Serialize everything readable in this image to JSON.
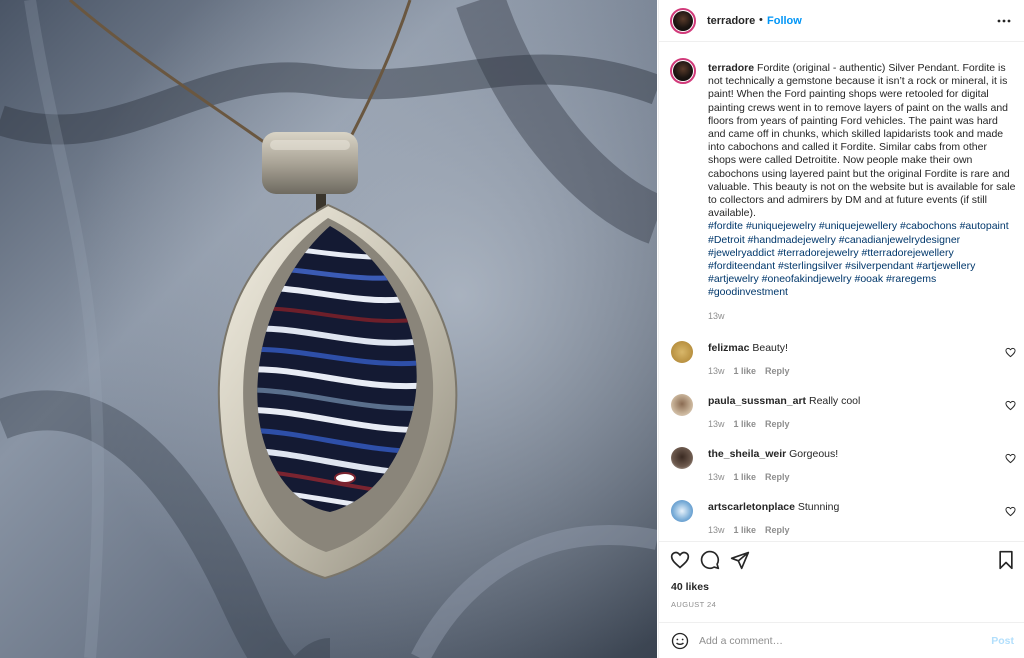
{
  "post": {
    "username": "terradore",
    "dot": "•",
    "follow_label": "Follow",
    "caption_username": "terradore",
    "caption_text": "Fordite (original - authentic) Silver Pendant. Fordite is not technically a gemstone because it isn’t a rock or mineral, it is paint! When the Ford painting shops were retooled for digital painting crews went in to remove layers of paint on the walls and floors from years of painting Ford vehicles. The paint was hard and came off in chunks, which skilled lapidarists took and made into cabochons and called it Fordite. Similar cabs from other shops were called Detroitite. Now people make their own cabochons using layered paint but the original Fordite is rare and valuable. This beauty is not on the website but is available for sale to collectors and admirers by DM and at future events (if still available).",
    "hashtags": "#fordite #uniquejewelry #uniquejewellery #cabochons #autopaint #Detroit #handmadejewelry #canadianjewelrydesigner #jewelryaddict #terradorejewelry #tterradorejewellery #forditeendant #sterlingsilver #silverpendant #artjewellery #artjewelry #oneofakindjewelry #ooak #raregems #goodinvestment",
    "caption_time": "13w",
    "likes": "40 likes",
    "date": "AUGUST 24"
  },
  "comments": [
    {
      "username": "felizmac",
      "text": "Beauty!",
      "time": "13w",
      "likes": "1 like",
      "reply": "Reply"
    },
    {
      "username": "paula_sussman_art",
      "text": "Really cool",
      "time": "13w",
      "likes": "1 like",
      "reply": "Reply"
    },
    {
      "username": "the_sheila_weir",
      "text": "Gorgeous!",
      "time": "13w",
      "likes": "1 like",
      "reply": "Reply"
    },
    {
      "username": "artscarletonplace",
      "text": "Stunning",
      "time": "13w",
      "likes": "1 like",
      "reply": "Reply"
    }
  ],
  "add_comment": {
    "placeholder": "Add a comment…",
    "post_label": "Post"
  },
  "colors": {
    "follow": "#0095f6",
    "hashtag": "#00376b",
    "muted": "#8e8e8e",
    "post_disabled": "#b2dffc"
  },
  "icons": {
    "more": "more-options-icon",
    "like": "heart-icon",
    "comment": "comment-icon",
    "share": "paper-plane-icon",
    "save": "bookmark-icon",
    "emoji": "emoji-icon"
  }
}
